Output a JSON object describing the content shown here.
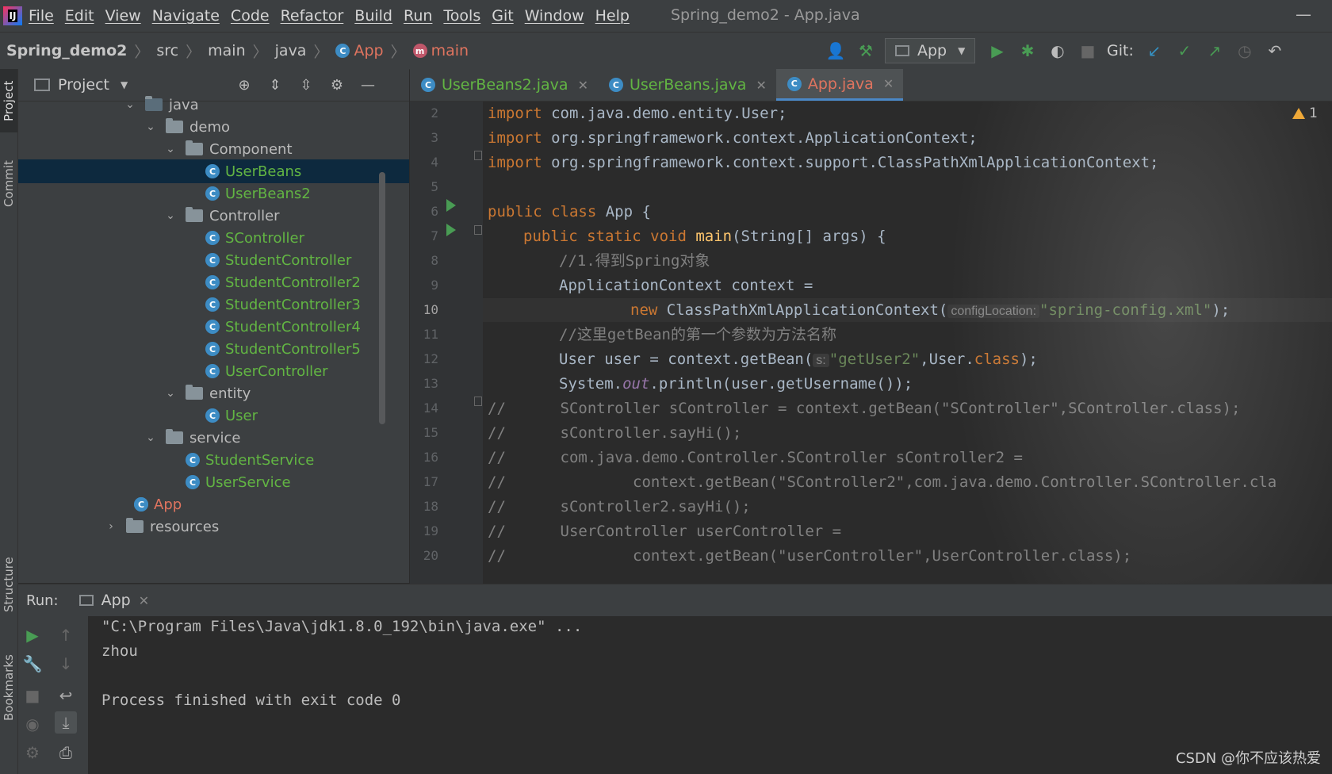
{
  "menubar": {
    "items": [
      "File",
      "Edit",
      "View",
      "Navigate",
      "Code",
      "Refactor",
      "Build",
      "Run",
      "Tools",
      "Git",
      "Window",
      "Help"
    ],
    "window_title": "Spring_demo2 - App.java",
    "logo_text": "IJ"
  },
  "navbar": {
    "crumbs": [
      "Spring_demo2",
      "src",
      "main",
      "java",
      "App",
      "main"
    ],
    "run_config": "App",
    "git_label": "Git:"
  },
  "stripe": {
    "project": "Project",
    "commit": "Commit",
    "structure": "Structure",
    "bookmarks": "Bookmarks"
  },
  "project_panel": {
    "title": "Project",
    "tree": [
      {
        "label": "java",
        "type": "folder"
      },
      {
        "label": "demo",
        "type": "folder"
      },
      {
        "label": "Component",
        "type": "folder"
      },
      {
        "label": "UserBeans",
        "type": "class"
      },
      {
        "label": "UserBeans2",
        "type": "class"
      },
      {
        "label": "Controller",
        "type": "folder"
      },
      {
        "label": "SController",
        "type": "class"
      },
      {
        "label": "StudentController",
        "type": "class"
      },
      {
        "label": "StudentController2",
        "type": "class"
      },
      {
        "label": "StudentController3",
        "type": "class"
      },
      {
        "label": "StudentController4",
        "type": "class"
      },
      {
        "label": "StudentController5",
        "type": "class"
      },
      {
        "label": "UserController",
        "type": "class"
      },
      {
        "label": "entity",
        "type": "folder"
      },
      {
        "label": "User",
        "type": "class"
      },
      {
        "label": "service",
        "type": "folder"
      },
      {
        "label": "StudentService",
        "type": "class"
      },
      {
        "label": "UserService",
        "type": "class"
      },
      {
        "label": "App",
        "type": "main-class"
      },
      {
        "label": "resources",
        "type": "folder"
      }
    ]
  },
  "editor": {
    "tabs": [
      {
        "label": "UserBeans2.java",
        "active": false
      },
      {
        "label": "UserBeans.java",
        "active": false
      },
      {
        "label": "App.java",
        "active": true
      }
    ],
    "warning_count": "1",
    "line_numbers": [
      "2",
      "3",
      "4",
      "5",
      "6",
      "7",
      "8",
      "9",
      "10",
      "11",
      "12",
      "13",
      "14",
      "15",
      "16",
      "17",
      "18",
      "19",
      "20"
    ],
    "current_line": "10",
    "hints": {
      "config_location": "configLocation:",
      "s": "s:"
    },
    "code": {
      "l2_kw": "import",
      "l2_rest": " com.java.demo.entity.User;",
      "l3_kw": "import",
      "l3_rest": " org.springframework.context.ApplicationContext;",
      "l4_kw": "import",
      "l4_rest": " org.springframework.context.support.ClassPathXmlApplicationContext;",
      "l6_kw": "public class",
      "l6_rest": " App {",
      "l7_kw": "public static void",
      "l7_fn": " main",
      "l7_rest": "(String[] args) {",
      "l8": "//1.得到Spring对象",
      "l9": "ApplicationContext context =",
      "l10_kw": "new",
      "l10_rest": " ClassPathXmlApplicationContext(",
      "l10_str": "\"spring-config.xml\"",
      "l10_end": ");",
      "l11": "//这里getBean的第一个参数为方法名称",
      "l12_a": "User user = context.getBean(",
      "l12_str": "\"getUser2\"",
      "l12_b": ",User.",
      "l12_kw": "class",
      "l12_c": ");",
      "l13_a": "System.",
      "l13_st": "out",
      "l13_b": ".println(user.getUsername());",
      "l14": "//      SController sController = context.getBean(\"SController\",SController.class);",
      "l15": "//      sController.sayHi();",
      "l16": "//      com.java.demo.Controller.SController sController2 =",
      "l17": "//              context.getBean(\"SController2\",com.java.demo.Controller.SController.cla",
      "l18": "//      sController2.sayHi();",
      "l19": "//      UserController userController =",
      "l20": "//              context.getBean(\"userController\",UserController.class);"
    }
  },
  "run_panel": {
    "label": "Run:",
    "tab": "App",
    "console": [
      "\"C:\\Program Files\\Java\\jdk1.8.0_192\\bin\\java.exe\" ...",
      "zhou",
      "",
      "Process finished with exit code 0"
    ]
  },
  "watermark": "CSDN @你不应该热爱",
  "colors": {
    "accent": "#4a88c7",
    "run_green": "#499c54",
    "class_blue": "#3d8cc4",
    "string_green": "#6a8759",
    "keyword_orange": "#cc7832"
  }
}
